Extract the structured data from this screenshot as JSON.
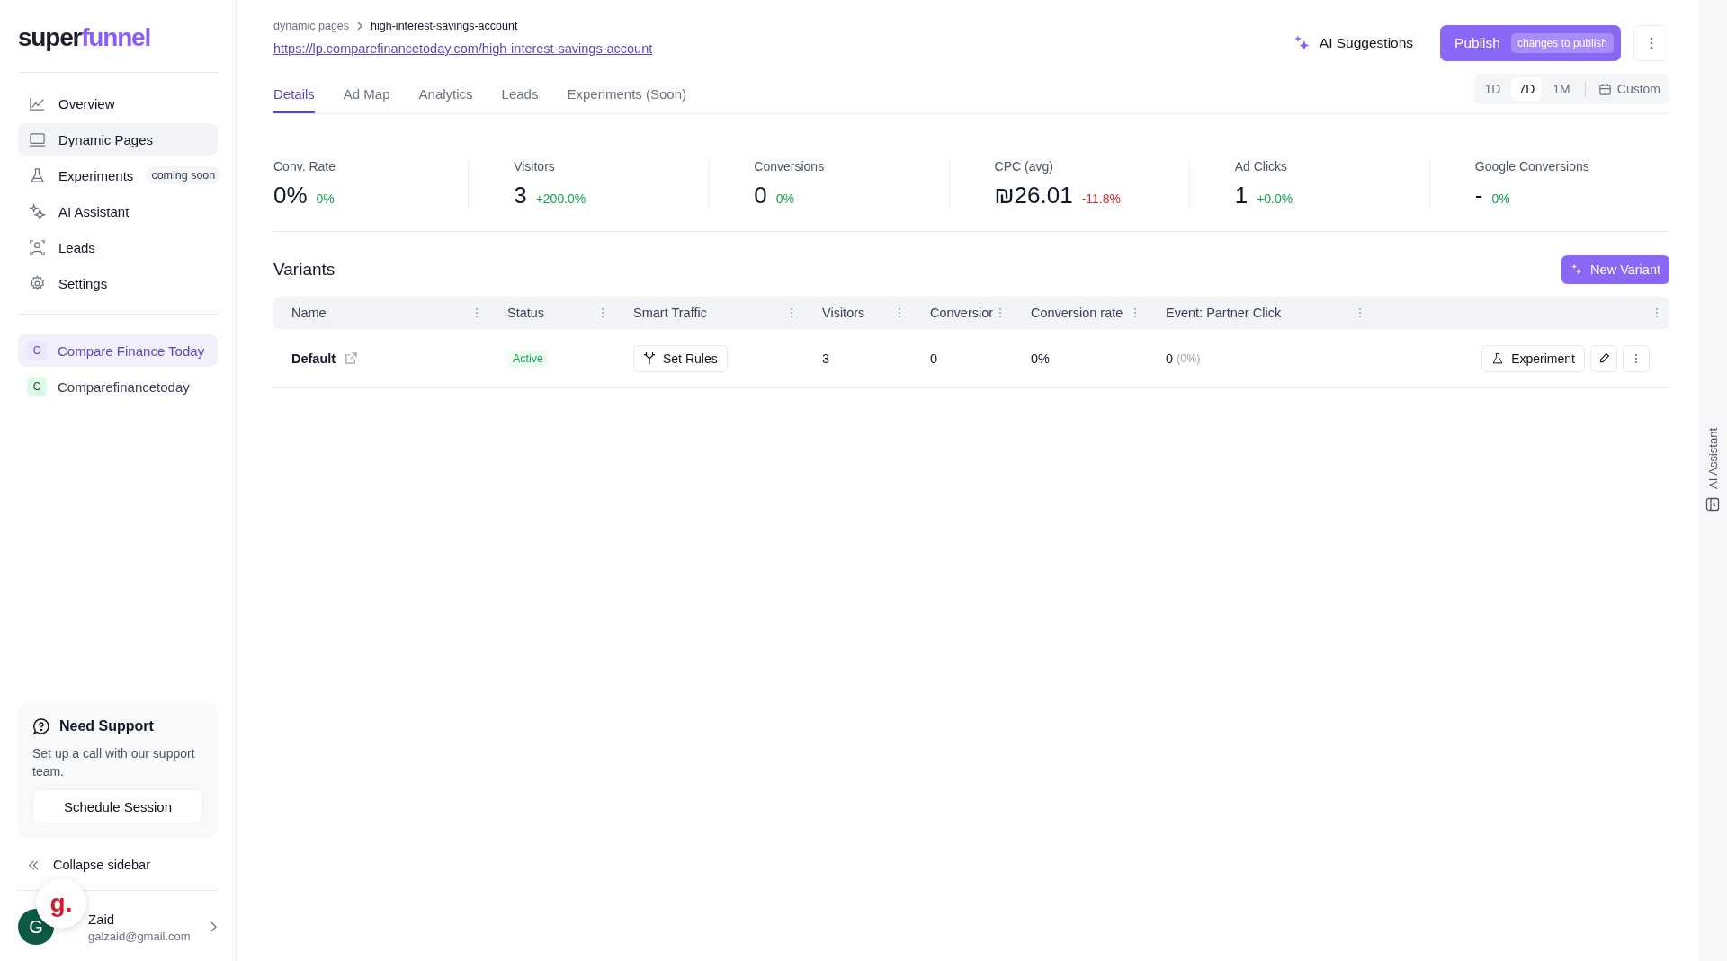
{
  "logo": {
    "dark": "super",
    "accent": "funnel"
  },
  "nav": [
    {
      "label": "Overview",
      "kind": "chart",
      "selected": false
    },
    {
      "label": "Dynamic Pages",
      "kind": "monitor",
      "selected": true
    },
    {
      "label": "Experiments",
      "kind": "flask",
      "selected": false,
      "badge": "coming soon"
    },
    {
      "label": "AI Assistant",
      "kind": "sparkle",
      "selected": false
    },
    {
      "label": "Leads",
      "kind": "person",
      "selected": false
    },
    {
      "label": "Settings",
      "kind": "gear",
      "selected": false
    }
  ],
  "projects": [
    {
      "initial": "C",
      "name": "Compare Finance Today",
      "selected": true
    },
    {
      "initial": "C",
      "name": "Comparefinancetoday",
      "selected": false
    }
  ],
  "support": {
    "title": "Need Support",
    "text": "Set up a call with our support team.",
    "button": "Schedule Session"
  },
  "collapse": "Collapse sidebar",
  "user": {
    "initial": "G",
    "name": "Zaid",
    "email": "galzaid@gmail.com"
  },
  "floating_badge": "g.",
  "breadcrumb": [
    "dynamic pages",
    "high-interest-savings-account"
  ],
  "url": "https://lp.comparefinancetoday.com/high-interest-savings-account",
  "ai_suggestions": "AI Suggestions",
  "publish": {
    "label": "Publish",
    "badge": "changes to publish"
  },
  "tabs": [
    {
      "label": "Details",
      "selected": true
    },
    {
      "label": "Ad Map",
      "selected": false
    },
    {
      "label": "Analytics",
      "selected": false
    },
    {
      "label": "Leads",
      "selected": false
    },
    {
      "label": "Experiments (Soon)",
      "selected": false
    }
  ],
  "ranges": [
    {
      "label": "1D",
      "selected": false
    },
    {
      "label": "7D",
      "selected": true
    },
    {
      "label": "1M",
      "selected": false
    }
  ],
  "custom_range": "Custom",
  "stats": [
    {
      "label": "Conv. Rate",
      "value": "0%",
      "delta": "0%",
      "color": "#16a34a"
    },
    {
      "label": "Visitors",
      "value": "3",
      "delta": "+200.0%",
      "color": "#16a34a"
    },
    {
      "label": "Conversions",
      "value": "0",
      "delta": "0%",
      "color": "#16a34a"
    },
    {
      "label": "CPC (avg)",
      "value": "₪26.01",
      "delta": "-11.8%",
      "color": "#dc2626"
    },
    {
      "label": "Ad Clicks",
      "value": "1",
      "delta": "+0.0%",
      "color": "#16a34a"
    },
    {
      "label": "Google Conversions",
      "value": "-",
      "delta": "0%",
      "color": "#16a34a"
    }
  ],
  "variants": {
    "title": "Variants",
    "new_button": "New Variant",
    "columns": [
      "Name",
      "Status",
      "Smart Traffic",
      "Visitors",
      "Conversior",
      "Conversion rate",
      "Event: Partner Click"
    ],
    "rows": [
      {
        "name": "Default",
        "status": "Active",
        "rules": "Set Rules",
        "visitors": "3",
        "conversions": "0",
        "rate": "0%",
        "event": "0",
        "event_share": "(0%)",
        "experiment": "Experiment"
      }
    ]
  },
  "side_panel": "AI Assistant"
}
